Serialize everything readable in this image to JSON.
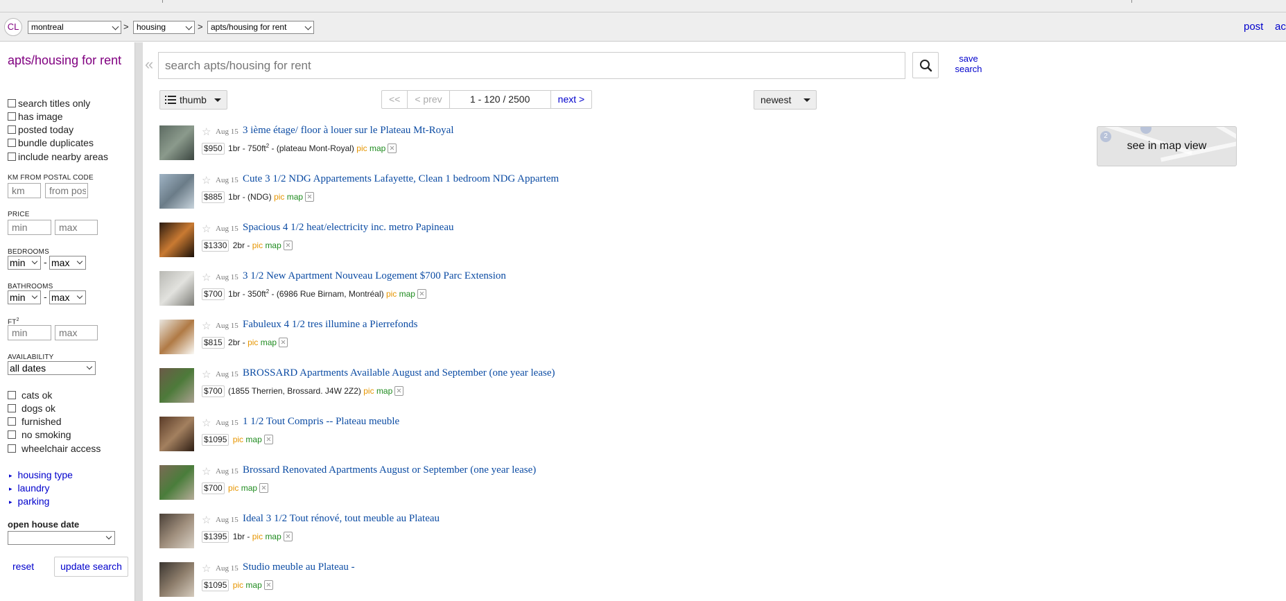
{
  "header": {
    "logo": "CL",
    "city_select": "montreal",
    "category_select": "housing",
    "subcategory_select": "apts/housing for rent",
    "separator": ">",
    "post_link": "post",
    "account_link": "ac"
  },
  "sidebar": {
    "title": "apts/housing for rent",
    "checkboxes_top": [
      "search titles only",
      "has image",
      "posted today",
      "bundle duplicates",
      "include nearby areas"
    ],
    "km_label": "KM FROM POSTAL CODE",
    "km_placeholder": "km",
    "postal_placeholder": "from pos",
    "price_label": "PRICE",
    "price_min": "min",
    "price_max": "max",
    "bedrooms_label": "BEDROOMS",
    "bedrooms_min": "min",
    "bedrooms_max": "max",
    "bathrooms_label": "BATHROOMS",
    "bathrooms_min": "min",
    "bathrooms_max": "max",
    "range_dash": "-",
    "ft_label": "FT",
    "ft_sup": "2",
    "ft_min": "min",
    "ft_max": "max",
    "availability_label": "AVAILABILITY",
    "availability_value": "all dates",
    "checkboxes_bottom": [
      "cats ok",
      "dogs ok",
      "furnished",
      "no smoking",
      "wheelchair access"
    ],
    "expandables": [
      "housing type",
      "laundry",
      "parking"
    ],
    "open_house_label": "open house date",
    "open_house_value": "",
    "reset_label": "reset",
    "update_label": "update search"
  },
  "search": {
    "collapse_glyph": "«",
    "placeholder": "search apts/housing for rent",
    "save_label_1": "save",
    "save_label_2": "search"
  },
  "controls": {
    "view_mode": "thumb",
    "first": "<<",
    "prev": "< prev",
    "range": "1 - 120 / 2500",
    "next": "next >",
    "sort": "newest"
  },
  "map": {
    "label": "see in map view",
    "pin_1": "2"
  },
  "listings": [
    {
      "date": "Aug 15",
      "title": "3 ième étage/ floor à louer sur le Plateau Mt-Royal",
      "price": "$950",
      "info": "1br - 750ft",
      "sup": "2",
      "info2": " - (plateau Mont-Royal)",
      "pic": "pic",
      "map": "map",
      "img_colors": [
        "#5d6b62",
        "#8b9a8c",
        "#3b4640"
      ]
    },
    {
      "date": "Aug 15",
      "title": "Cute 3 1/2 NDG Appartements Lafayette, Clean 1 bedroom NDG Appartem",
      "price": "$885",
      "info": "1br - (NDG)",
      "sup": "",
      "info2": "",
      "pic": "pic",
      "map": "map",
      "img_colors": [
        "#9fb3c4",
        "#6b7c88",
        "#c7d3dc"
      ]
    },
    {
      "date": "Aug 15",
      "title": "Spacious 4 1/2 heat/electricity inc. metro Papineau",
      "price": "$1330",
      "info": "2br -",
      "sup": "",
      "info2": "",
      "pic": "pic",
      "map": "map",
      "img_colors": [
        "#2a1a10",
        "#c97a32",
        "#1a1008"
      ]
    },
    {
      "date": "Aug 15",
      "title": "3 1/2 New Apartment Nouveau Logement $700 Parc Extension",
      "price": "$700",
      "info": "1br - 350ft",
      "sup": "2",
      "info2": " - (6986 Rue Birnam, Montréal)",
      "pic": "pic",
      "map": "map",
      "img_colors": [
        "#b9b9b4",
        "#e2e2de",
        "#7d7d78"
      ]
    },
    {
      "date": "Aug 15",
      "title": "Fabuleux 4 1/2 tres illumine a Pierrefonds",
      "price": "$815",
      "info": "2br -",
      "sup": "",
      "info2": "",
      "pic": "pic",
      "map": "map",
      "img_colors": [
        "#e9e6df",
        "#b07a45",
        "#fbfaf6"
      ]
    },
    {
      "date": "Aug 15",
      "title": "BROSSARD Apartments Available August and September (one year lease)",
      "price": "$700",
      "info": "(1855 Therrien, Brossard. J4W 2Z2)",
      "sup": "",
      "info2": "",
      "pic": "pic",
      "map": "map",
      "img_colors": [
        "#6b5a48",
        "#4d7a3a",
        "#a9a08f"
      ]
    },
    {
      "date": "Aug 15",
      "title": "1 1/2 Tout Compris -- Plateau meuble",
      "price": "$1095",
      "info": "",
      "sup": "",
      "info2": "",
      "pic": "pic",
      "map": "map",
      "img_colors": [
        "#5a3b28",
        "#a3805f",
        "#2d1d13"
      ]
    },
    {
      "date": "Aug 15",
      "title": "Brossard Renovated Apartments August or September (one year lease)",
      "price": "$700",
      "info": "",
      "sup": "",
      "info2": "",
      "pic": "pic",
      "map": "map",
      "img_colors": [
        "#7b6a55",
        "#4a7d3b",
        "#b5ab98"
      ]
    },
    {
      "date": "Aug 15",
      "title": "Ideal 3 1/2 Tout rénové, tout meuble au Plateau",
      "price": "$1395",
      "info": "1br -",
      "sup": "",
      "info2": "",
      "pic": "pic",
      "map": "map",
      "img_colors": [
        "#4a4038",
        "#9d8c7a",
        "#d8d0c5"
      ]
    },
    {
      "date": "Aug 15",
      "title": "Studio meuble au Plateau -",
      "price": "$1095",
      "info": "",
      "sup": "",
      "info2": "",
      "pic": "pic",
      "map": "map",
      "img_colors": [
        "#3a3530",
        "#8c7c6a",
        "#d5cbbd"
      ]
    }
  ],
  "colors": {
    "accent_purple": "#800080",
    "link_blue": "#0000cc",
    "title_blue": "#0b4ba3",
    "pic_orange": "#e69500",
    "map_green": "#1f8b1f"
  }
}
